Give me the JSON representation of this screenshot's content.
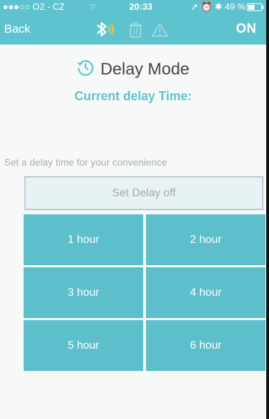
{
  "status_bar": {
    "carrier": "●●●○○ O2 - CZ",
    "time": "20:33",
    "battery": "49 %"
  },
  "nav": {
    "back_label": "Back",
    "power_label": "ON"
  },
  "page": {
    "title": "Delay Mode",
    "subtitle": "Current delay Time:",
    "hint": "Set a delay time for your convenience",
    "delay_off_label": "Set Delay off"
  },
  "options": [
    "1 hour",
    "2 hour",
    "3 hour",
    "4 hour",
    "5 hour",
    "6 hour"
  ],
  "colors": {
    "accent": "#5fc3cf",
    "button": "#5cbfcb"
  }
}
